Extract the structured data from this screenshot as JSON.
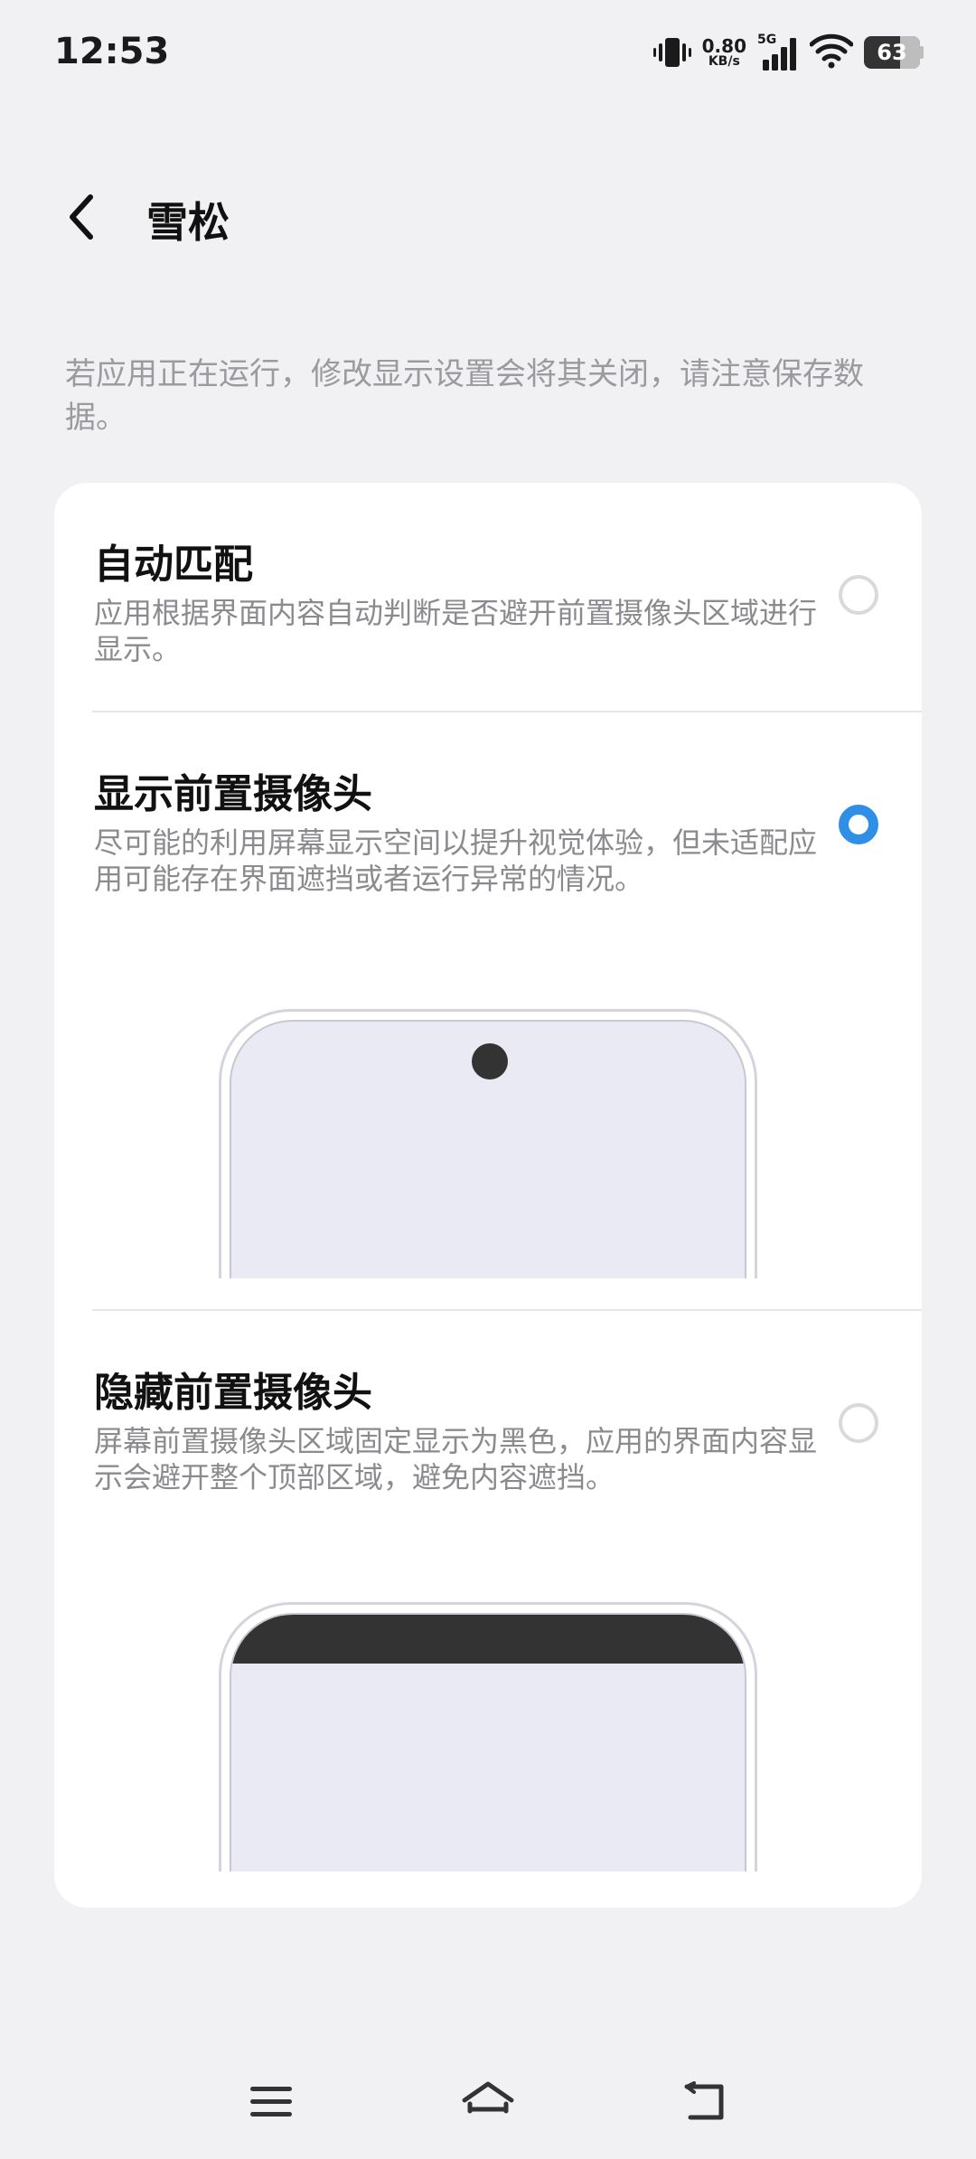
{
  "status_bar": {
    "time": "12:53",
    "net_speed_value": "0.80",
    "net_speed_unit": "KB/s",
    "network_type": "5G",
    "battery_level": "63",
    "icons": [
      "vibrate-icon",
      "signal-icon",
      "wifi-icon",
      "battery-icon"
    ]
  },
  "header": {
    "title": "雪松",
    "back_icon": "chevron-left-icon"
  },
  "notice": "若应用正在运行，修改显示设置会将其关闭，请注意保存数据。",
  "options": [
    {
      "title": "自动匹配",
      "description": "应用根据界面内容自动判断是否避开前置摄像头区域进行显示。",
      "selected": false
    },
    {
      "title": "显示前置摄像头",
      "description": "尽可能的利用屏幕显示空间以提升视觉体验，但未适配应用可能存在界面遮挡或者运行异常的情况。",
      "selected": true
    },
    {
      "title": "隐藏前置摄像头",
      "description": "屏幕前置摄像头区域固定显示为黑色，应用的界面内容显示会避开整个顶部区域，避免内容遮挡。",
      "selected": false
    }
  ],
  "colors": {
    "accent": "#2f8fe6",
    "background": "#f1f1f4",
    "card": "#ffffff",
    "illustration_screen": "#e9eaf4",
    "camera_black": "#333333"
  },
  "nav_bar": {
    "icons": [
      "menu-icon",
      "home-icon",
      "back-icon"
    ]
  }
}
